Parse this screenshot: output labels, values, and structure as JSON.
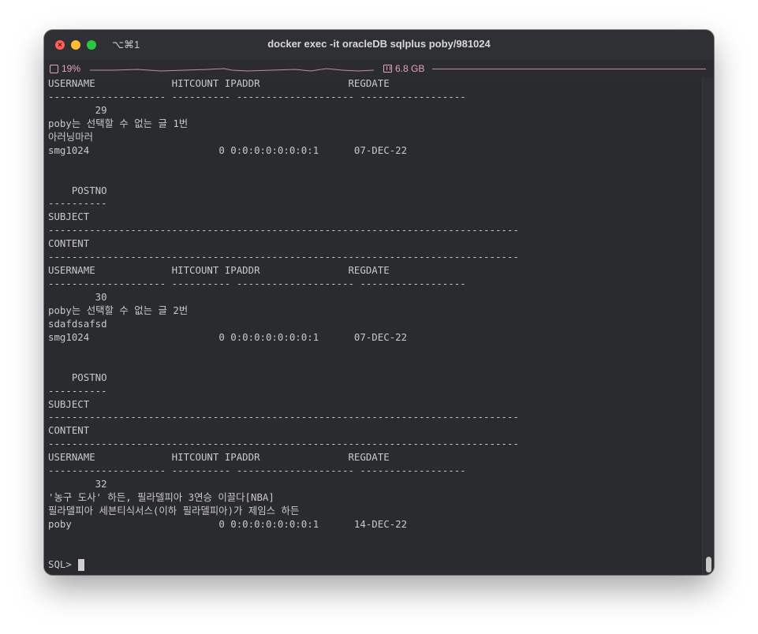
{
  "window": {
    "title": "docker exec -it oracleDB sqlplus poby/981024",
    "shortcut": "⌥⌘1"
  },
  "status": {
    "cpu": "19%",
    "memory": "6.8 GB"
  },
  "terminal": {
    "lines": [
      "USERNAME             HITCOUNT IPADDR               REGDATE",
      "-------------------- ---------- -------------------- ------------------",
      "        29",
      "poby는 선택할 수 없는 글 1번",
      "아러닝마러",
      "smg1024                      0 0:0:0:0:0:0:0:1      07-DEC-22",
      "",
      "",
      "    POSTNO",
      "----------",
      "SUBJECT",
      "--------------------------------------------------------------------------------",
      "CONTENT",
      "--------------------------------------------------------------------------------",
      "USERNAME             HITCOUNT IPADDR               REGDATE",
      "-------------------- ---------- -------------------- ------------------",
      "        30",
      "poby는 선택할 수 없는 글 2번",
      "sdafdsafsd",
      "smg1024                      0 0:0:0:0:0:0:0:1      07-DEC-22",
      "",
      "",
      "    POSTNO",
      "----------",
      "SUBJECT",
      "--------------------------------------------------------------------------------",
      "CONTENT",
      "--------------------------------------------------------------------------------",
      "USERNAME             HITCOUNT IPADDR               REGDATE",
      "-------------------- ---------- -------------------- ------------------",
      "        32",
      "'농구 도사' 하든, 필라델피아 3연승 이끌다[NBA]",
      "필라델피아 세븐티식서스(이하 필라델피아)가 제임스 하든",
      "poby                         0 0:0:0:0:0:0:0:1      14-DEC-22",
      "",
      ""
    ],
    "prompt": "SQL> "
  }
}
